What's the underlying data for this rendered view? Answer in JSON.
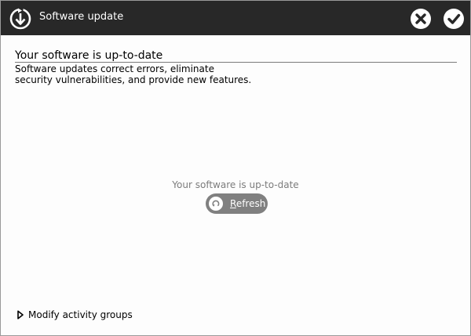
{
  "window": {
    "title": "Software update"
  },
  "icons": {
    "app": "software-update-icon",
    "cancel": "close-icon",
    "ok": "checkmark-icon",
    "refresh": "refresh-icon",
    "expander": "triangle-right-icon"
  },
  "colors": {
    "titlebar_bg": "#282828",
    "refresh_button_bg": "#808080",
    "status_text": "#7c7c7c"
  },
  "content": {
    "heading": "Your software is up-to-date",
    "description_line1": "Software updates correct errors, eliminate",
    "description_line2": "security vulnerabilities, and provide new features.",
    "status": "Your software is up-to-date",
    "refresh_mnemonic": "R",
    "refresh_rest": "efresh",
    "expander_label": "Modify activity groups"
  }
}
